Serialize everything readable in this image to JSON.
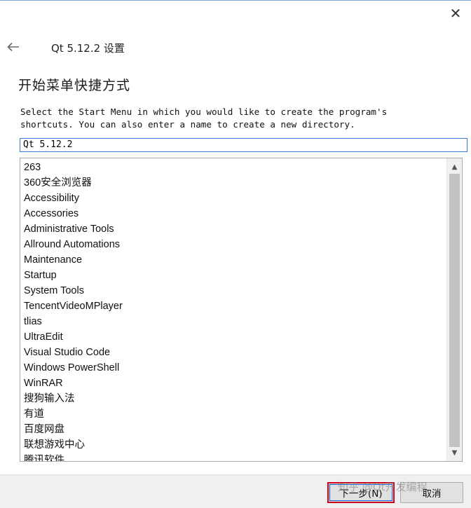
{
  "window": {
    "title": "Qt 5.12.2 设置",
    "close_glyph": "✕"
  },
  "page": {
    "heading": "开始菜单快捷方式",
    "description": "Select the Start Menu in which you would like to create the program's\nshortcuts. You can also enter a name to create a new directory."
  },
  "directory_input": {
    "value": "Qt 5.12.2"
  },
  "folder_list": {
    "items": [
      "263",
      "360安全浏览器",
      "Accessibility",
      "Accessories",
      "Administrative Tools",
      "Allround Automations",
      "Maintenance",
      "Startup",
      "System Tools",
      "TencentVideoMPlayer",
      "tlias",
      "UltraEdit",
      "Visual Studio Code",
      "Windows PowerShell",
      "WinRAR",
      "搜狗输入法",
      "有道",
      "百度网盘",
      "联想游戏中心",
      "腾讯软件"
    ],
    "scroll_up_glyph": "▲",
    "scroll_down_glyph": "▼"
  },
  "buttons": {
    "next_label": "下一步(N)",
    "cancel_label": "取消"
  },
  "watermark": "知乎 @Qt开发编程",
  "icons": {
    "back": "back-arrow-icon",
    "close": "close-icon"
  },
  "colors": {
    "input_focus_border": "#3a7bd5",
    "highlight_box": "#d0021b",
    "footer_bg": "#f0f0f0"
  }
}
